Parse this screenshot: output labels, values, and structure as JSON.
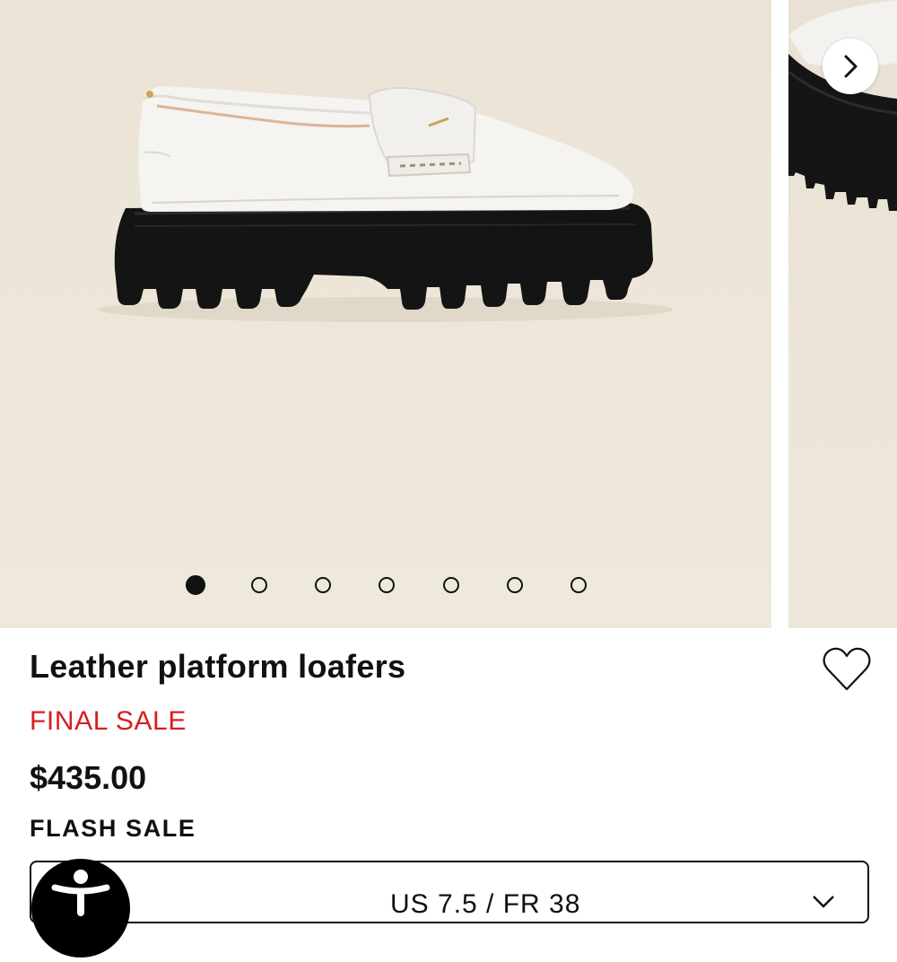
{
  "product": {
    "title": "Leather platform loafers",
    "sale_badge": "FINAL SALE",
    "price": "$435.00",
    "promo_label": "FLASH SALE",
    "favorite_icon": "heart-outline-icon"
  },
  "gallery": {
    "image_count": 7,
    "active_index": 0,
    "next_icon": "chevron-right-icon"
  },
  "size_selector": {
    "selected_value": "US 7.5 / FR 38",
    "icon": "chevron-down-icon"
  },
  "accessibility": {
    "icon": "accessibility-person-icon"
  },
  "colors": {
    "sale_red": "#d81e1e",
    "text": "#111111",
    "backdrop": "#ece5d7"
  }
}
